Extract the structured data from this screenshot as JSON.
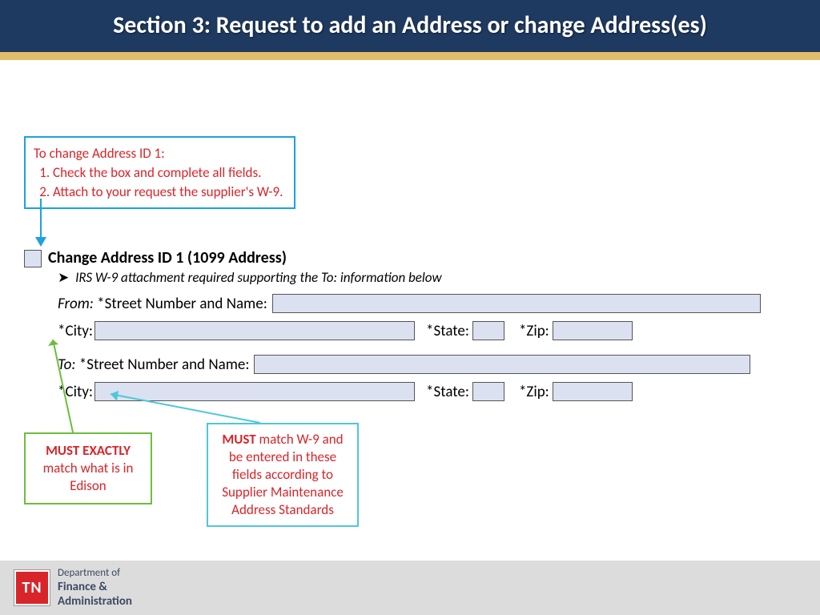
{
  "header": {
    "title": "Section 3: Request to add an Address or change Address(es)"
  },
  "callout_top": {
    "intro": "To change Address ID 1:",
    "items": [
      "Check the box and complete all fields.",
      "Attach to your request the supplier's W-9."
    ]
  },
  "form": {
    "title": "Change Address ID 1 (1099 Address)",
    "note": "IRS W-9 attachment required supporting the To: information below",
    "from_label": "From:",
    "to_label": "To:",
    "street_label": "*Street Number and Name:",
    "city_label": "*City:",
    "state_label": "*State:",
    "zip_label": "*Zip:"
  },
  "callout_green": {
    "bold": "MUST EXACTLY",
    "rest": "match what is in Edison"
  },
  "callout_cyan": {
    "bold": "MUST",
    "rest": "match W-9 and be entered in these fields according to Supplier Maintenance Address Standards"
  },
  "footer": {
    "logo": "TN",
    "line1": "Department of",
    "line2": "Finance &",
    "line3": "Administration"
  }
}
